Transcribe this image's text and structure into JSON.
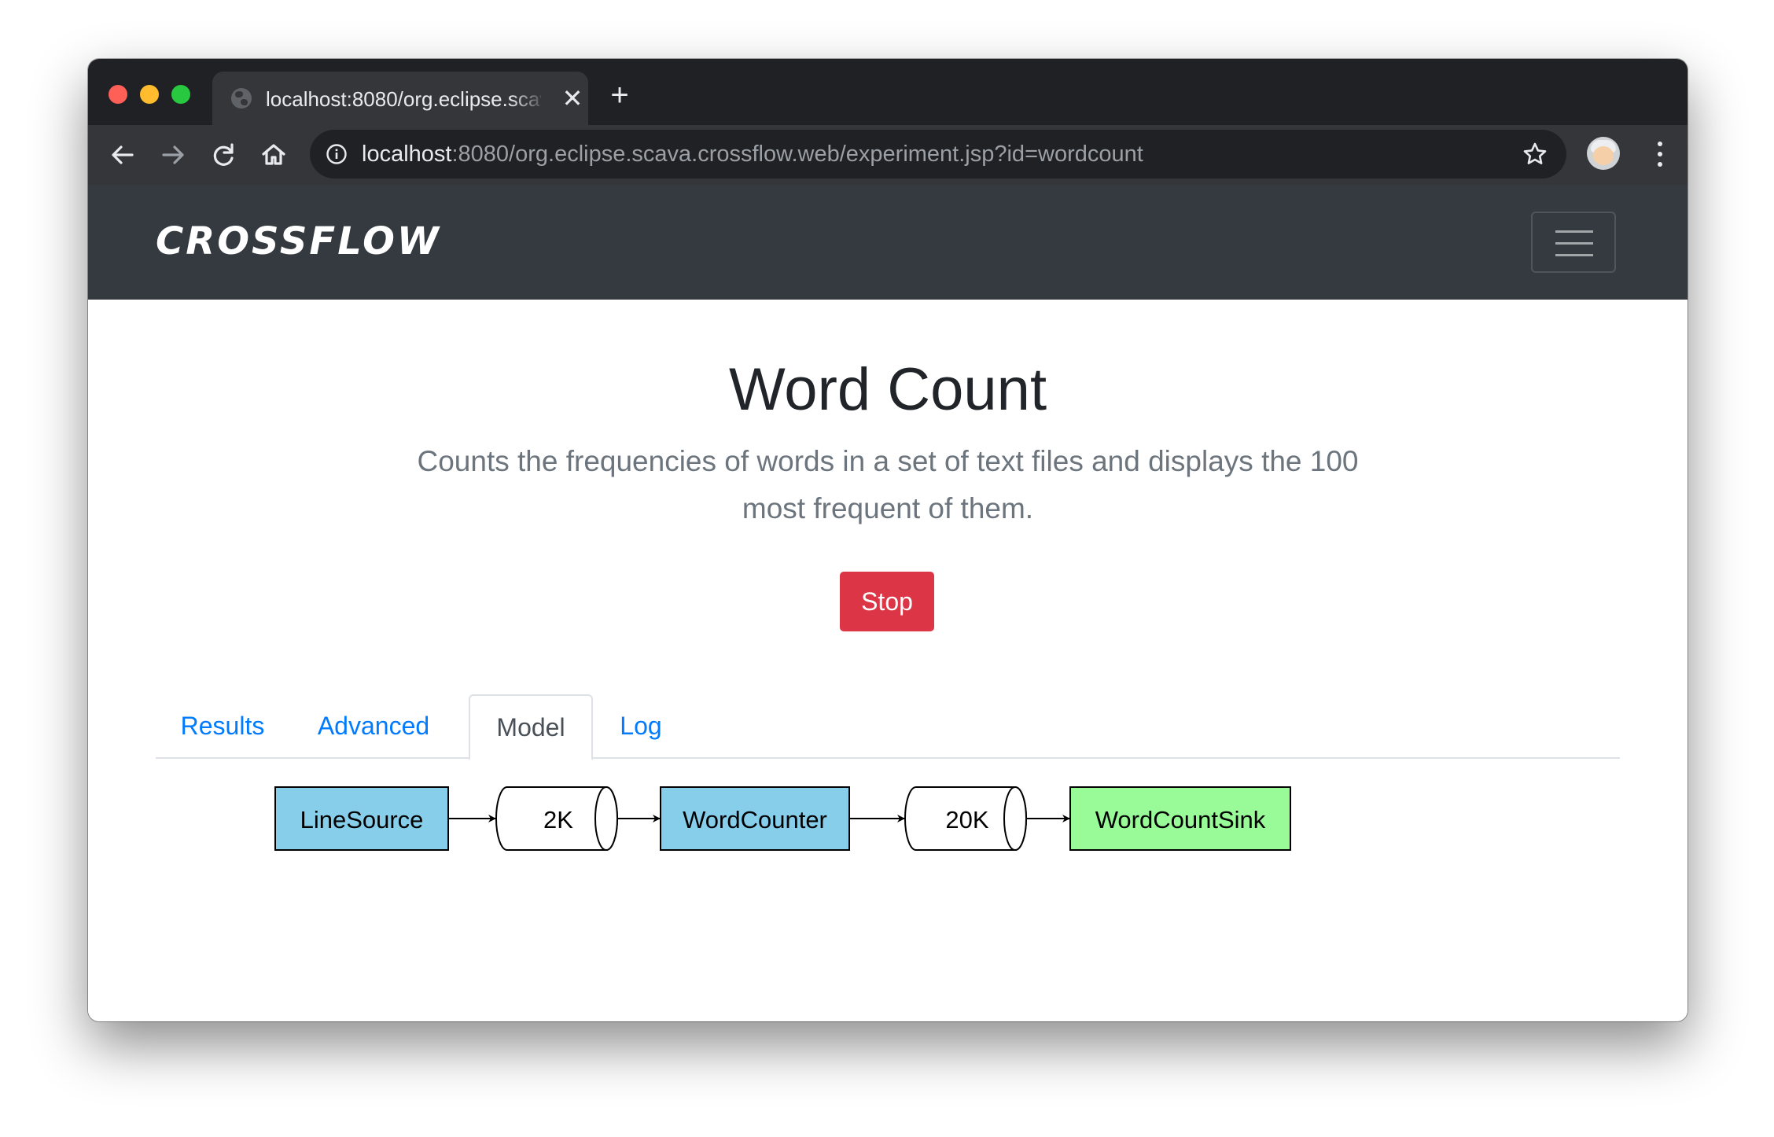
{
  "browser": {
    "tab_title": "localhost:8080/org.eclipse.scava.crossflow.web/experiment.jsp?id=wordcount",
    "tab_close_glyph": "✕",
    "new_tab_glyph": "+",
    "url_host": "localhost",
    "url_rest": ":8080/org.eclipse.scava.crossflow.web/experiment.jsp?id=wordcount",
    "icons": [
      "back-icon",
      "forward-icon",
      "reload-icon",
      "home-icon",
      "info-icon",
      "star-icon",
      "profile-avatar",
      "menu-dots-icon"
    ]
  },
  "navbar": {
    "brand": "CROSSFLOW",
    "toggler_icon": "hamburger-icon"
  },
  "experiment": {
    "title": "Word Count",
    "description": "Counts the frequencies of words in a set of text files and displays the 100 most frequent of them.",
    "stop_label": "Stop"
  },
  "tabs": {
    "results": "Results",
    "advanced": "Advanced",
    "model": "Model",
    "log": "Log",
    "active": "Model"
  },
  "model": {
    "nodes": [
      {
        "kind": "task",
        "label": "LineSource",
        "color": "#87ceeb"
      },
      {
        "kind": "queue",
        "label": "2K"
      },
      {
        "kind": "task",
        "label": "WordCounter",
        "color": "#87ceeb"
      },
      {
        "kind": "queue",
        "label": "20K"
      },
      {
        "kind": "task",
        "label": "WordCountSink",
        "color": "#98fb98"
      }
    ]
  },
  "colors": {
    "navbar": "#343a40",
    "danger": "#dc3545",
    "link": "#007bff",
    "task_blue": "#87ceeb",
    "task_green": "#98fb98"
  }
}
